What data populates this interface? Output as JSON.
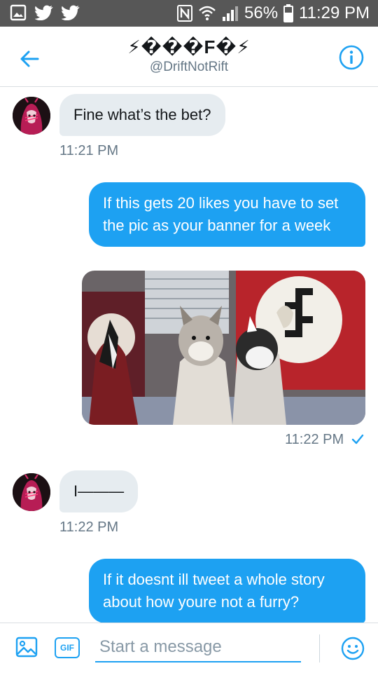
{
  "status_bar": {
    "battery": "56%",
    "time": "11:29 PM"
  },
  "header": {
    "title": "⚡���F�⚡",
    "handle": "@DriftNotRift"
  },
  "messages": [
    {
      "direction": "in",
      "text": "Fine what’s the bet?",
      "time": "11:21 PM"
    },
    {
      "direction": "out",
      "text": "If this gets 20 likes you have to set the pic as your banner for a week",
      "time": "11:22 PM"
    },
    {
      "direction": "in",
      "text": "I———",
      "time": "11:22 PM"
    },
    {
      "direction": "out",
      "text": "If it doesnt ill tweet a whole story about how youre not a furry?"
    }
  ],
  "composer": {
    "placeholder": "Start a message",
    "gif_label": "GIF"
  },
  "colors": {
    "accent": "#1da1f2",
    "incoming_bubble": "#e6ecf0",
    "status_bar": "#575757"
  },
  "icons": [
    "gallery-icon",
    "twitter-bird-icon",
    "nfc-icon",
    "wifi-icon",
    "signal-icon",
    "battery-icon",
    "back-arrow-icon",
    "info-icon",
    "read-check-icon",
    "image-icon",
    "gif-icon",
    "emoji-icon"
  ]
}
